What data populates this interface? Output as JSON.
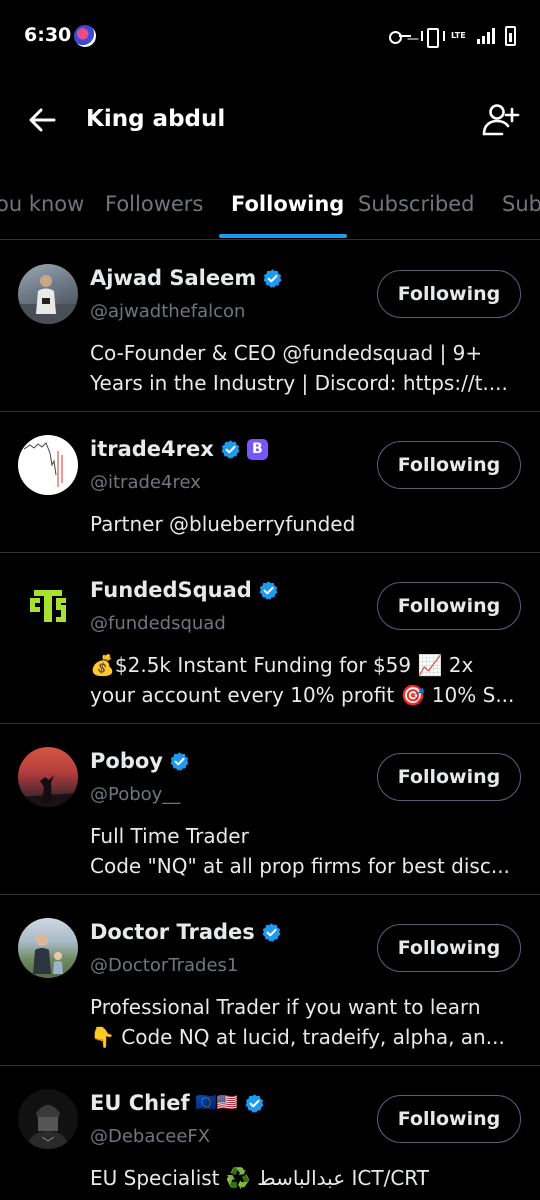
{
  "status_bar": {
    "time": "6:30",
    "network": "LTE"
  },
  "header": {
    "title": "King abdul"
  },
  "tabs": [
    {
      "label": "ou know"
    },
    {
      "label": "Followers"
    },
    {
      "label": "Following"
    },
    {
      "label": "Subscribed"
    },
    {
      "label": "Sub"
    }
  ],
  "active_tab": "Following",
  "accounts": [
    {
      "name": "Ajwad Saleem",
      "handle": "@ajwadthefalcon",
      "verified": true,
      "button": "Following",
      "bio": [
        "Co-Founder & CEO @fundedsquad | 9+",
        "Years in the Industry |  Discord: https://t...."
      ]
    },
    {
      "name": "itrade4rex",
      "handle": "@itrade4rex",
      "verified": true,
      "badge": "B",
      "button": "Following",
      "bio": [
        "Partner @blueberryfunded"
      ]
    },
    {
      "name": "FundedSquad",
      "handle": "@fundedsquad",
      "verified": true,
      "button": "Following",
      "bio": [
        "💰$2.5k Instant Funding for $59 📈 2x",
        "your account every 10% profit 🎯 10% S..."
      ]
    },
    {
      "name": "Poboy",
      "handle": "@Poboy__",
      "verified": true,
      "button": "Following",
      "bio": [
        "Full Time Trader",
        "Code \"NQ\" at all prop firms for best disc..."
      ]
    },
    {
      "name": "Doctor Trades",
      "handle": "@DoctorTrades1",
      "verified": true,
      "button": "Following",
      "bio": [
        "Professional Trader if you want to learn",
        "👇 Code NQ at lucid, tradeify, alpha, an..."
      ]
    },
    {
      "name": "EU Chief",
      "flags": "🇪🇺🇺🇸",
      "handle": "@DebaceeFX",
      "verified": true,
      "button": "Following",
      "bio": [
        "EU Specialist ♻️ عبدالباسط ICT/CRT"
      ]
    }
  ],
  "colors": {
    "accent": "#1d9bf0",
    "background": "#000000",
    "muted": "#71767b",
    "badge_b": "#7856ff",
    "fundedsquad_logo": "#a6e22e"
  }
}
